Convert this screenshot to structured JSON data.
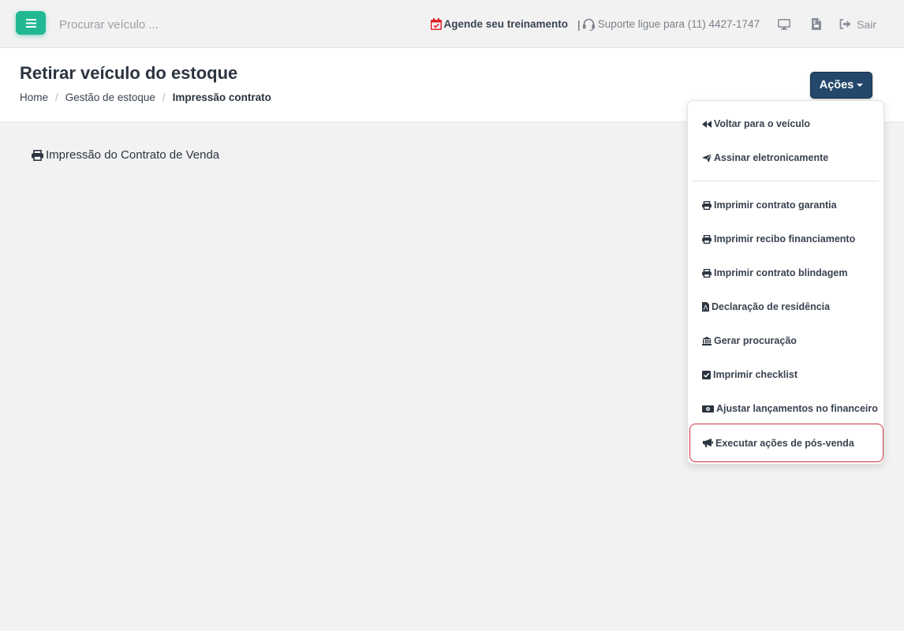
{
  "topbar": {
    "search_placeholder": "Procurar veículo ...",
    "agende_label": "Agende seu treinamento",
    "separator": "|",
    "suporte_label": "Suporte ligue para (11) 4427-1747",
    "sair_label": "Sair"
  },
  "header": {
    "title": "Retirar veículo do estoque",
    "breadcrumb": [
      "Home",
      "Gestão de estoque",
      "Impressão contrato"
    ],
    "acoes_label": "Ações"
  },
  "content": {
    "title": "Impressão do Contrato de Venda"
  },
  "dropdown": {
    "items": [
      {
        "label": "Voltar para o veículo",
        "icon": "backward-icon"
      },
      {
        "label": "Assinar eletronicamente",
        "icon": "paper-plane-icon"
      },
      {
        "label": "Imprimir contrato garantia",
        "icon": "print-icon"
      },
      {
        "label": "Imprimir recibo financiamento",
        "icon": "print-icon"
      },
      {
        "label": "Imprimir contrato blindagem",
        "icon": "print-icon"
      },
      {
        "label": "Declaração de residência",
        "icon": "pdf-file-icon"
      },
      {
        "label": "Gerar procuração",
        "icon": "bank-icon"
      },
      {
        "label": "Imprimir checklist",
        "icon": "check-square-icon"
      },
      {
        "label": "Ajustar lançamentos no financeiro",
        "icon": "money-bill-icon"
      },
      {
        "label": "Executar ações de pós-venda",
        "icon": "bullhorn-icon"
      }
    ]
  },
  "colors": {
    "accent": "#22b893",
    "acoes_button": "#23486b",
    "highlight_border": "#c6343e",
    "calendar_icon": "#e0202a"
  }
}
